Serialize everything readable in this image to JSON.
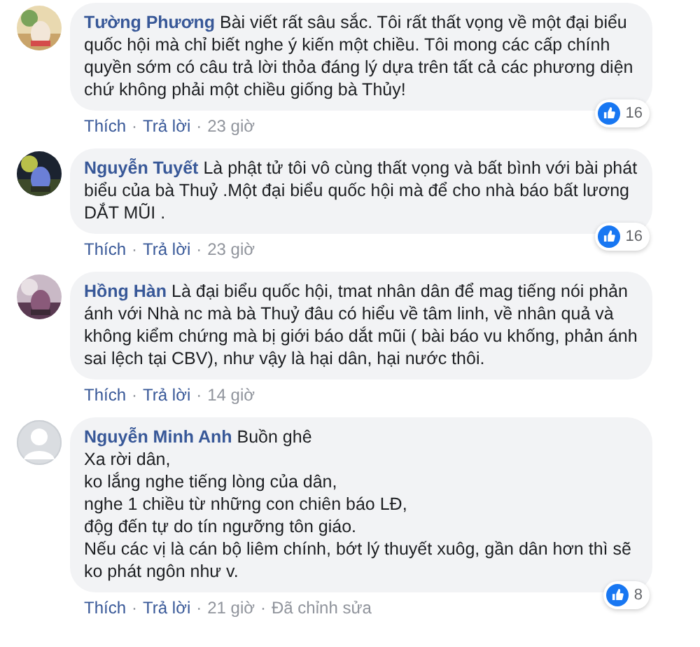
{
  "comments": [
    {
      "author": "Tường Phương",
      "text": "Bài viết rất sâu sắc. Tôi rất thất vọng về một đại biểu quốc hội mà chỉ biết nghe ý kiến một chiều. Tôi mong các cấp chính quyền sớm có câu trả lời thỏa đáng lý dựa trên tất cả các phương diện chứ không phải một chiều giống bà Thủy!",
      "likes": "16",
      "actions": [
        {
          "kind": "link",
          "text": "Thích"
        },
        {
          "kind": "separator",
          "text": "·"
        },
        {
          "kind": "link",
          "text": "Trả lời"
        },
        {
          "kind": "separator",
          "text": "·"
        },
        {
          "kind": "meta",
          "text": "23 giờ"
        }
      ]
    },
    {
      "author": "Nguyễn Tuyết",
      "text": "Là phật tử tôi vô cùng thất vọng và bất bình với bài phát biểu của bà Thuỷ .Một đại biểu quốc hội mà để cho nhà báo bất lương DẮT MŨI .",
      "likes": "16",
      "actions": [
        {
          "kind": "link",
          "text": "Thích"
        },
        {
          "kind": "separator",
          "text": "·"
        },
        {
          "kind": "link",
          "text": "Trả lời"
        },
        {
          "kind": "separator",
          "text": "·"
        },
        {
          "kind": "meta",
          "text": "23 giờ"
        }
      ]
    },
    {
      "author": "Hồng Hàn",
      "text": "Là đại biểu quốc hội, tmat nhân dân để mag tiếng nói phản ánh với Nhà nc mà bà Thuỷ đâu có hiểu về tâm linh, về nhân quả và không kiểm chứng mà bị giới báo dắt mũi ( bài báo vu khống, phản ánh sai lệch tại CBV), như vậy là hại dân, hại nước thôi.",
      "actions": [
        {
          "kind": "link",
          "text": "Thích"
        },
        {
          "kind": "separator",
          "text": "·"
        },
        {
          "kind": "link",
          "text": "Trả lời"
        },
        {
          "kind": "separator",
          "text": "·"
        },
        {
          "kind": "meta",
          "text": "14 giờ"
        }
      ]
    },
    {
      "avatar": {
        "kind": "default"
      },
      "author": "Nguyễn Minh Anh",
      "text": "Buồn ghê\nXa rời dân,\nko lắng nghe tiếng lòng của dân,\nnghe 1 chiều từ những con chiên báo LĐ,\nđộg đến tự do tín ngưỡng tôn giáo.\nNếu các vị là cán bộ liêm chính, bớt lý thuyết xuôg, gần dân hơn thì sẽ ko phát ngôn như v.",
      "likes": "8",
      "actions": [
        {
          "kind": "link",
          "text": "Thích"
        },
        {
          "kind": "separator",
          "text": "·"
        },
        {
          "kind": "link",
          "text": "Trả lời"
        },
        {
          "kind": "separator",
          "text": "·"
        },
        {
          "kind": "meta",
          "text": "21 giờ"
        },
        {
          "kind": "separator",
          "text": "·"
        },
        {
          "kind": "meta",
          "text": "Đã chỉnh sửa"
        }
      ]
    }
  ]
}
